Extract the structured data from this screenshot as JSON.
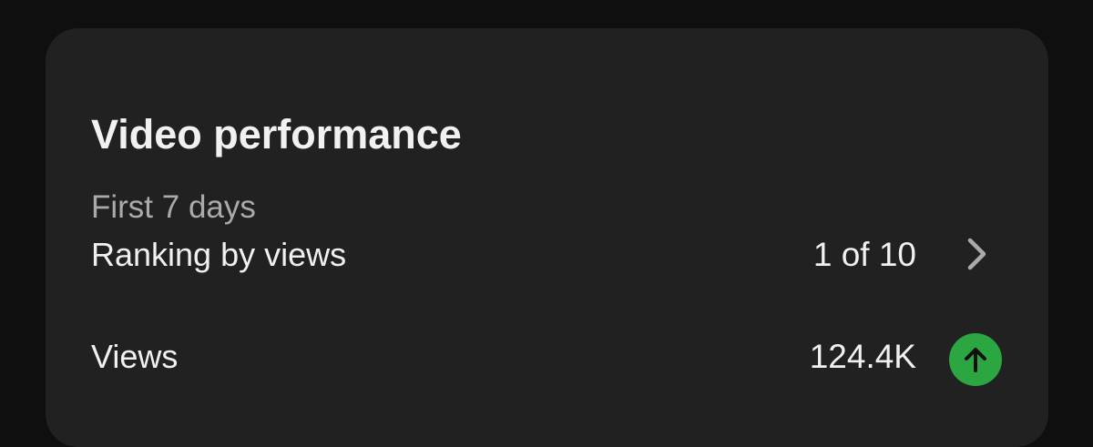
{
  "card": {
    "title": "Video performance",
    "subtitle": "First 7 days"
  },
  "rows": [
    {
      "label": "Ranking by views",
      "value": "1 of 10",
      "icon": "chevron-right-icon"
    },
    {
      "label": "Views",
      "value": "124.4K",
      "icon": "arrow-up-icon",
      "icon_color": "#2ba640"
    }
  ],
  "colors": {
    "page_background": "#0f0f0f",
    "card_background": "#212121",
    "text_primary": "#f1f1f1",
    "text_secondary": "#aaaaaa",
    "trend_up": "#2ba640"
  }
}
